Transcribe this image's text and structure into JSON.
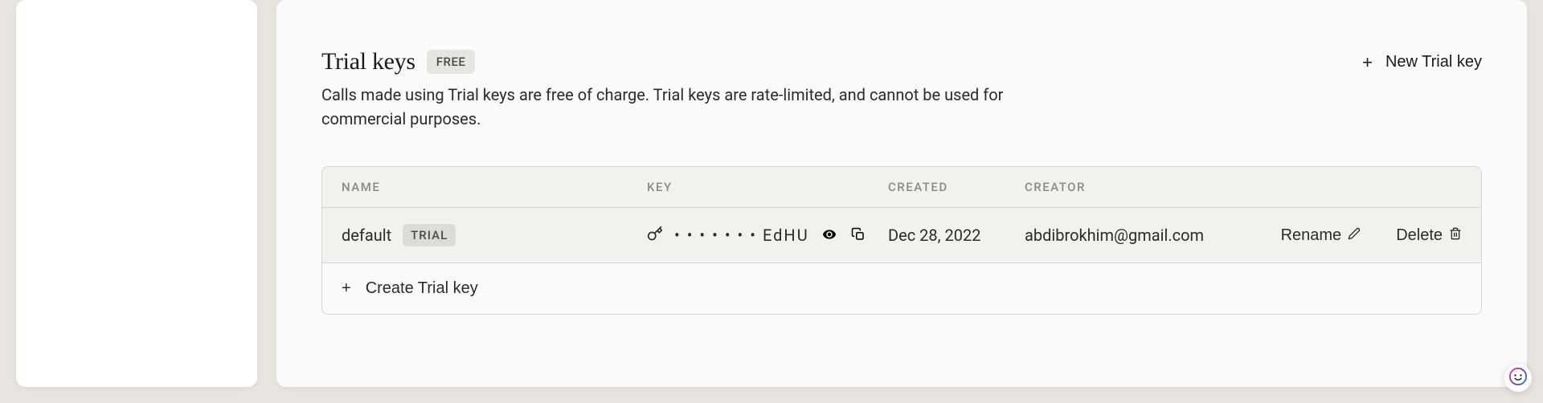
{
  "section": {
    "title": "Trial keys",
    "badge": "FREE",
    "description": "Calls made using Trial keys are free of charge. Trial keys are rate-limited, and cannot be used for commercial purposes.",
    "new_button": "New Trial key"
  },
  "table": {
    "headers": {
      "name": "NAME",
      "key": "KEY",
      "created": "CREATED",
      "creator": "CREATOR"
    },
    "rows": [
      {
        "name": "default",
        "badge": "TRIAL",
        "key_masked": "• • • • • • • EdHU",
        "created": "Dec 28, 2022",
        "creator": "abdibrokhim@gmail.com"
      }
    ],
    "actions": {
      "rename": "Rename",
      "delete": "Delete"
    },
    "footer_button": "Create Trial key"
  }
}
